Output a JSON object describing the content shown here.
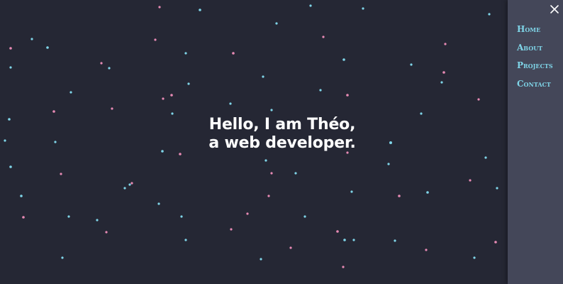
{
  "hero": {
    "line1": "Hello, I am Théo,",
    "line2": "a web developer."
  },
  "menu": {
    "close_icon": "close-icon",
    "items": [
      {
        "label": "Home"
      },
      {
        "label": "About"
      },
      {
        "label": "Projects"
      },
      {
        "label": "Contact"
      }
    ]
  },
  "colors": {
    "background": "#252734",
    "panel": "#444759",
    "nav_text": "#7fd5e8",
    "hero_text": "#ffffff",
    "particle_pink": "#e88ab4",
    "particle_cyan": "#7fd5e8"
  }
}
